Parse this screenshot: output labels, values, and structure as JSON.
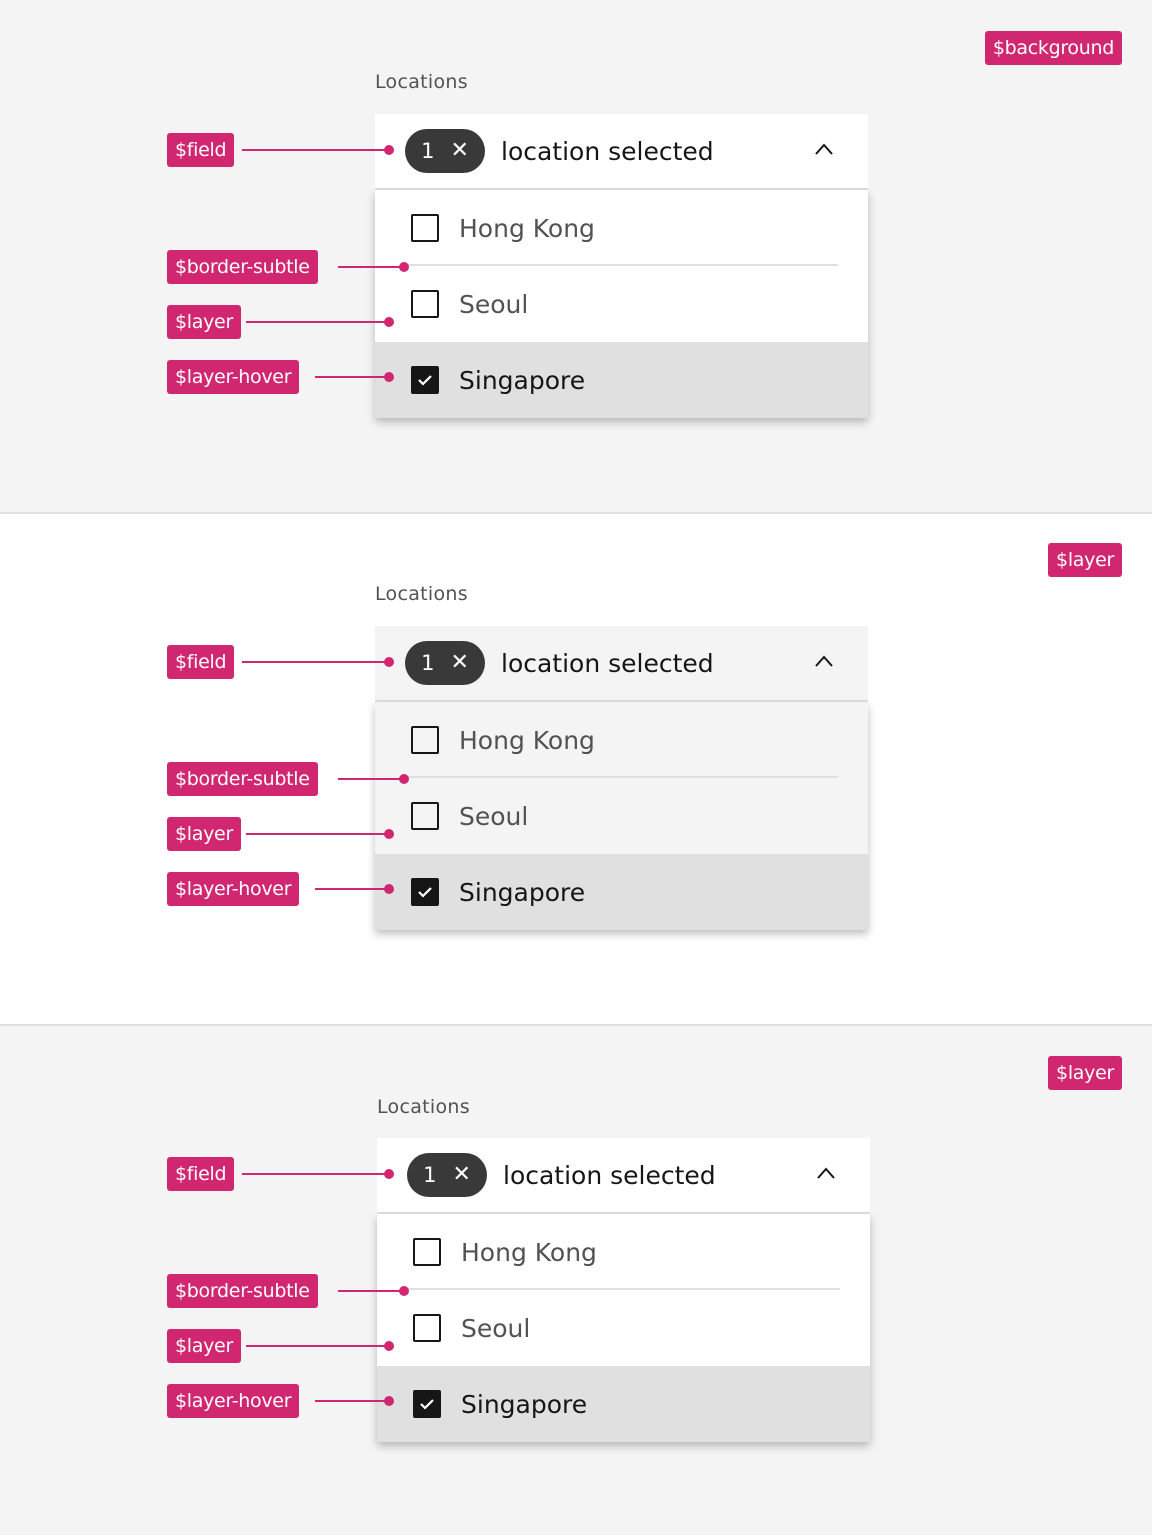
{
  "colors": {
    "annotation": "#d12771",
    "background": "#f4f4f4",
    "layer_white": "#ffffff",
    "layer_hover": "#e0e0e0",
    "border_subtle": "#e0e0e0",
    "tag_bg": "#393939",
    "text_primary": "#161616",
    "text_secondary": "#525252"
  },
  "panels": [
    {
      "theme_token": "$background",
      "label": "Locations",
      "selected_count": "1",
      "field_text": "location selected",
      "options": [
        {
          "label": "Hong Kong",
          "checked": false
        },
        {
          "label": "Seoul",
          "checked": false
        },
        {
          "label": "Singapore",
          "checked": true
        }
      ],
      "annotations": {
        "field": "$field",
        "border": "$border-subtle",
        "layer": "$layer",
        "hover": "$layer-hover"
      }
    },
    {
      "theme_token": "$layer",
      "label": "Locations",
      "selected_count": "1",
      "field_text": "location selected",
      "options": [
        {
          "label": "Hong Kong",
          "checked": false
        },
        {
          "label": "Seoul",
          "checked": false
        },
        {
          "label": "Singapore",
          "checked": true
        }
      ],
      "annotations": {
        "field": "$field",
        "border": "$border-subtle",
        "layer": "$layer",
        "hover": "$layer-hover"
      }
    },
    {
      "theme_token": "$layer",
      "label": "Locations",
      "selected_count": "1",
      "field_text": "location selected",
      "options": [
        {
          "label": "Hong Kong",
          "checked": false
        },
        {
          "label": "Seoul",
          "checked": false
        },
        {
          "label": "Singapore",
          "checked": true
        }
      ],
      "annotations": {
        "field": "$field",
        "border": "$border-subtle",
        "layer": "$layer",
        "hover": "$layer-hover"
      }
    }
  ]
}
